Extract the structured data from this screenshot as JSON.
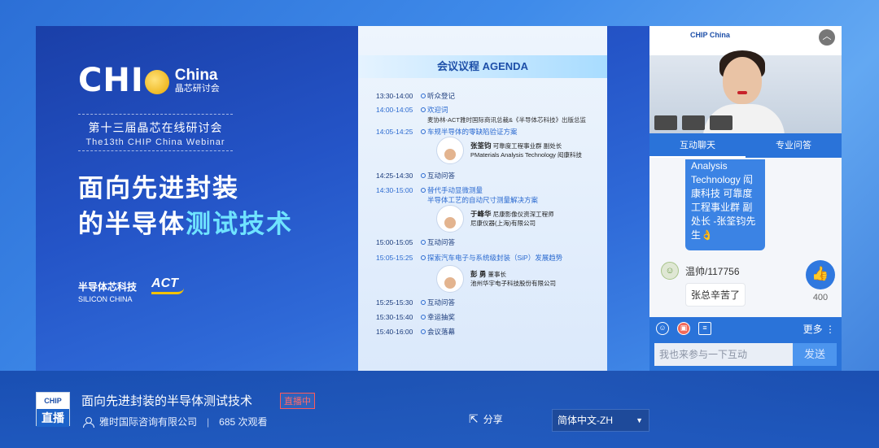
{
  "slide": {
    "logo_chip": "CHIP",
    "logo_china_en": "China",
    "logo_china_zh": "晶芯研讨会",
    "edition_zh": "第十三届晶芯在线研讨会",
    "edition_en": "The13th CHIP China Webinar",
    "title_line1": "面向先进封装",
    "title_line2_a": "的半导体",
    "title_line2_hl": "测试技术",
    "sponsor_zh": "半导体芯科技",
    "sponsor_en": "SILICON CHINA",
    "sponsor_act": "ACT"
  },
  "agenda": {
    "header": "会议议程  AGENDA",
    "items": [
      {
        "time": "13:30-14:00",
        "text": "听众登记",
        "sub": ""
      },
      {
        "time": "14:00-14:05",
        "text": "欢迎词",
        "sub": "麦协林-ACT雅时国际商讯总裁&《半导体芯科技》出版总监"
      },
      {
        "time": "14:05-14:25",
        "text": "车规半导体的零缺陷验证方案",
        "sub": ""
      },
      {
        "time": "14:25-14:30",
        "text": "互动问答",
        "sub": ""
      },
      {
        "time": "14:30-15:00",
        "text": "替代手动显微测量",
        "sub": "半导体工艺的自动尺寸测量解决方案"
      },
      {
        "time": "15:00-15:05",
        "text": "互动问答",
        "sub": ""
      },
      {
        "time": "15:05-15:25",
        "text": "探索汽车电子与系统级封装（SiP）发展趋势",
        "sub": ""
      },
      {
        "time": "15:25-15:30",
        "text": "互动问答",
        "sub": ""
      },
      {
        "time": "15:30-15:40",
        "text": "幸运抽奖",
        "sub": ""
      },
      {
        "time": "15:40-16:00",
        "text": "会议落幕",
        "sub": ""
      }
    ],
    "speakers": [
      {
        "name": "张筌钧",
        "role": "可靠度工程事业群 副处长",
        "org": "PMaterials Analysis Technology 闳康科技"
      },
      {
        "name": "于峰华",
        "role": "尼康影像仪资深工程师",
        "org": "尼康仪器(上海)有限公司"
      },
      {
        "name": "彭 勇",
        "role": "董事长",
        "org": "池州华宇电子科技股份有限公司"
      }
    ]
  },
  "side": {
    "cam_logo": "CHIP China",
    "tabs": [
      "互动聊天",
      "专业问答"
    ],
    "bubble_text": "Analysis Technology 闳康科技 可靠度工程事业群 副处长 -张筌钧先生👌",
    "chat_user": "温帅/117756",
    "chat_msg": "张总辛苦了",
    "like_count": "400",
    "more_label": "更多",
    "input_placeholder": "我也来参与一下互动",
    "send_label": "发送"
  },
  "bottom": {
    "live_logo_top": "CHIP China",
    "live_logo_bottom": "直播",
    "title": "面向先进封装的半导体测试技术",
    "live_badge": "直播中",
    "owner": "雅时国际咨询有限公司",
    "views": "685 次观看",
    "share_label": "分享",
    "language": "简体中文-ZH"
  }
}
